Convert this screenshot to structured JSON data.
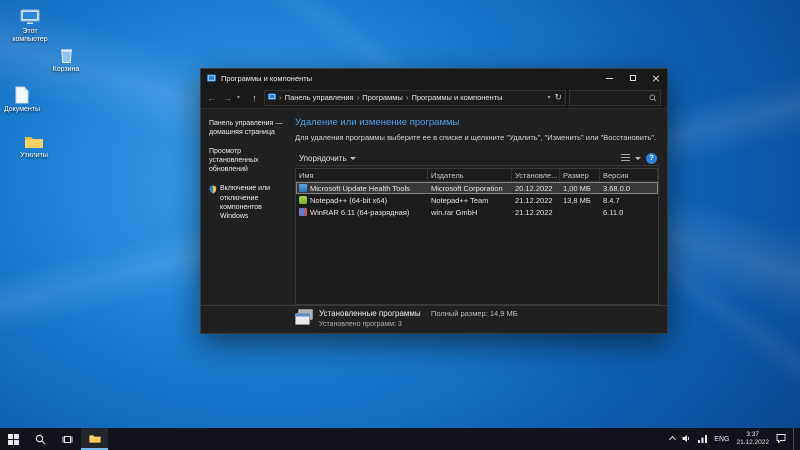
{
  "desktop": {
    "icons": [
      {
        "label": "Этот компьютер"
      },
      {
        "label": "Корзина"
      },
      {
        "label": "Документы"
      },
      {
        "label": "Утилиты"
      }
    ]
  },
  "window": {
    "title": "Программы и компоненты",
    "address": {
      "breadcrumb": [
        "Панель управления",
        "Программы",
        "Программы и компоненты"
      ]
    },
    "nav": [
      {
        "label": "Панель управления — домашняя страница"
      },
      {
        "label": "Просмотр установленных обновлений"
      },
      {
        "label": "Включение или отключение компонентов Windows"
      }
    ],
    "main": {
      "heading": "Удаление или изменение программы",
      "description": "Для удаления программы выберите ее в списке и щелкните \"Удалить\", \"Изменить\" или \"Восстановить\".",
      "organize_label": "Упорядочить",
      "help_label": "?",
      "columns": [
        "Имя",
        "Издатель",
        "Установле...",
        "Размер",
        "Версия"
      ],
      "rows": [
        {
          "name": "Microsoft Update Health Tools",
          "publisher": "Microsoft Corporation",
          "installed": "20.12.2022",
          "size": "1,00 МБ",
          "version": "3.68.0.0"
        },
        {
          "name": "Notepad++ (64-bit x64)",
          "publisher": "Notepad++ Team",
          "installed": "21.12.2022",
          "size": "13,8 МБ",
          "version": "8.4.7"
        },
        {
          "name": "WinRAR 6.11 (64-разрядная)",
          "publisher": "win.rar GmbH",
          "installed": "21.12.2022",
          "size": "",
          "version": "6.11.0"
        }
      ]
    },
    "status": {
      "title": "Установленные программы",
      "total_size": "Полный размер: 14,9 МБ",
      "count": "Установлено программ: 3"
    }
  },
  "taskbar": {
    "language": "ENG",
    "time": "3:37",
    "date": "21.12.2022"
  }
}
